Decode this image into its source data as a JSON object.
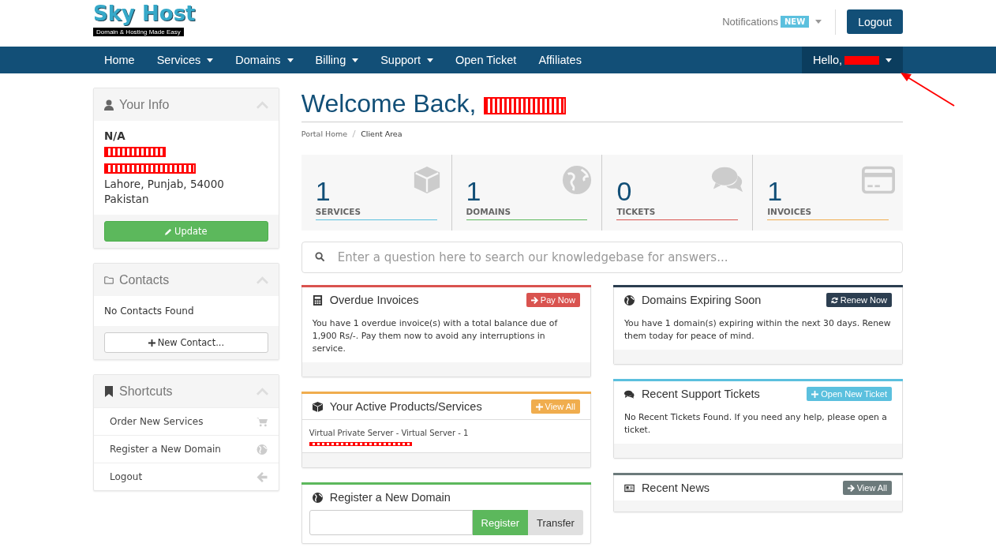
{
  "header": {
    "logo_title": "Sky Host",
    "logo_tagline": "Domain & Hosting Made Easy",
    "notifications": "Notifications",
    "notifications_badge": "NEW",
    "logout": "Logout"
  },
  "nav": {
    "items": [
      {
        "label": "Home",
        "dropdown": false
      },
      {
        "label": "Services",
        "dropdown": true
      },
      {
        "label": "Domains",
        "dropdown": true
      },
      {
        "label": "Billing",
        "dropdown": true
      },
      {
        "label": "Support",
        "dropdown": true
      },
      {
        "label": "Open Ticket",
        "dropdown": false
      },
      {
        "label": "Affiliates",
        "dropdown": false
      }
    ],
    "user": "Hello,"
  },
  "sidebar": {
    "your_info": {
      "title": "Your Info",
      "name": "N/A",
      "address_lines": [
        "Lahore, Punjab, 54000",
        "Pakistan"
      ],
      "button": "Update"
    },
    "contacts": {
      "title": "Contacts",
      "empty": "No Contacts Found",
      "button": "New Contact..."
    },
    "shortcuts": {
      "title": "Shortcuts",
      "items": [
        {
          "label": "Order New Services"
        },
        {
          "label": "Register a New Domain"
        },
        {
          "label": "Logout"
        }
      ]
    }
  },
  "main": {
    "title": "Welcome Back,",
    "breadcrumb": [
      "Portal Home",
      "Client Area"
    ],
    "stats": [
      {
        "count": "1",
        "label": "SERVICES",
        "color": "#5bc0de"
      },
      {
        "count": "1",
        "label": "DOMAINS",
        "color": "#5cb85c"
      },
      {
        "count": "0",
        "label": "TICKETS",
        "color": "#d9534f"
      },
      {
        "count": "1",
        "label": "INVOICES",
        "color": "#f0ad4e"
      }
    ],
    "search": {
      "placeholder": "Enter a question here to search our knowledgebase for answers..."
    },
    "panels_left": [
      {
        "kind": "text",
        "title": "Overdue Invoices",
        "button": "Pay Now",
        "color": "#d9534f",
        "text": "You have 1 overdue invoice(s) with a total balance due of 1,900 Rs/-. Pay them now to avoid any interruptions in service."
      },
      {
        "kind": "list",
        "title": "Your Active Products/Services",
        "button": "View All",
        "color": "#f0ad4e",
        "item": "Virtual Private Server - Virtual Server - 1"
      },
      {
        "kind": "domain",
        "title": "Register a New Domain",
        "color": "#5cb85c",
        "register": "Register",
        "transfer": "Transfer"
      }
    ],
    "panels_right": [
      {
        "kind": "text",
        "title": "Domains Expiring Soon",
        "button": "Renew Now",
        "color": "#2c3e50",
        "text": "You have 1 domain(s) expiring within the next 30 days. Renew them today for peace of mind."
      },
      {
        "kind": "text",
        "title": "Recent Support Tickets",
        "button": "Open New Ticket",
        "color": "#5bc0de",
        "text": "No Recent Tickets Found. If you need any help, please open a ticket."
      },
      {
        "kind": "news",
        "title": "Recent News",
        "button": "View All",
        "color": "#6c7a7b"
      }
    ]
  }
}
